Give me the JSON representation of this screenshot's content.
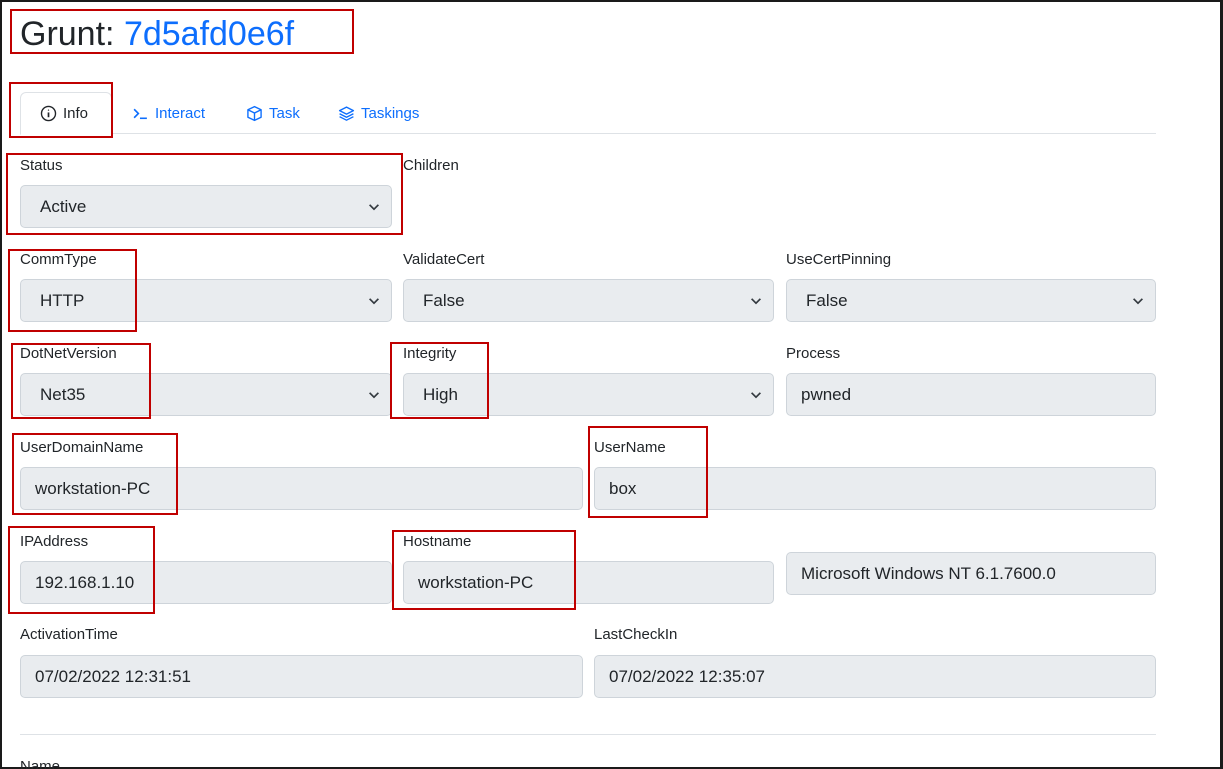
{
  "header": {
    "prefix": "Grunt:",
    "grunt_id": "7d5afd0e6f"
  },
  "tabs": [
    {
      "label": "Info",
      "icon": "info-circle-icon",
      "active": true
    },
    {
      "label": "Interact",
      "icon": "terminal-prompt-icon",
      "active": false
    },
    {
      "label": "Task",
      "icon": "box-icon",
      "active": false
    },
    {
      "label": "Taskings",
      "icon": "layers-icon",
      "active": false
    }
  ],
  "form": {
    "status": {
      "label": "Status",
      "value": "Active"
    },
    "children": {
      "label": "Children"
    },
    "commtype": {
      "label": "CommType",
      "value": "HTTP"
    },
    "validatecert": {
      "label": "ValidateCert",
      "value": "False"
    },
    "usecertpinning": {
      "label": "UseCertPinning",
      "value": "False"
    },
    "dotnetversion": {
      "label": "DotNetVersion",
      "value": "Net35"
    },
    "integrity": {
      "label": "Integrity",
      "value": "High"
    },
    "process": {
      "label": "Process",
      "value": "pwned"
    },
    "userdomainname": {
      "label": "UserDomainName",
      "value": "workstation-PC"
    },
    "username": {
      "label": "UserName",
      "value": "box"
    },
    "ipaddress": {
      "label": "IPAddress",
      "value": "192.168.1.10"
    },
    "hostname": {
      "label": "Hostname",
      "value": "workstation-PC"
    },
    "os": {
      "value": "Microsoft Windows NT 6.1.7600.0"
    },
    "activationtime": {
      "label": "ActivationTime",
      "value": "07/02/2022 12:31:51"
    },
    "lastcheckin": {
      "label": "LastCheckIn",
      "value": "07/02/2022 12:35:07"
    },
    "name": {
      "label": "Name"
    }
  },
  "colors": {
    "link": "#0d6efd",
    "highlight": "#c00000",
    "field_bg": "#e9ecef"
  }
}
